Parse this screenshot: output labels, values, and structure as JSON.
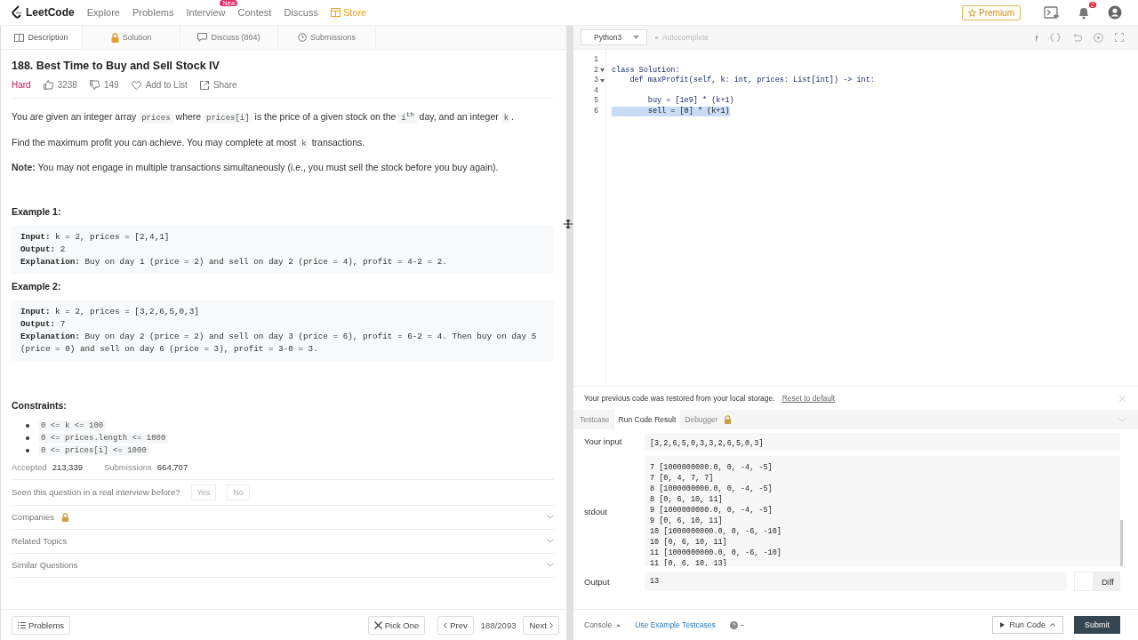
{
  "nav": {
    "logo": "LeetCode",
    "links": [
      {
        "label": "Explore",
        "kind": "plain"
      },
      {
        "label": "Problems",
        "kind": "plain"
      },
      {
        "label": "Interview",
        "kind": "plain",
        "badge": "New"
      },
      {
        "label": "Contest",
        "kind": "plain"
      },
      {
        "label": "Discuss",
        "kind": "plain"
      },
      {
        "label": "Store",
        "kind": "store"
      }
    ],
    "premium": "Premium",
    "notifications": "2"
  },
  "tabs": [
    {
      "label": "Description",
      "selected": true
    },
    {
      "label": "Solution",
      "selected": false
    },
    {
      "label": "Discuss (804)",
      "selected": false
    },
    {
      "label": "Submissions",
      "selected": false
    }
  ],
  "problem": {
    "title": "188. Best Time to Buy and Sell Stock IV",
    "difficulty": "Hard",
    "likes": "3238",
    "dislikes": "149",
    "add_to_list": "Add to List",
    "share": "Share"
  },
  "paragraphs": [
    [
      {
        "text": "You are given an integer array ",
        "kind": "text"
      },
      {
        "text": "prices",
        "kind": "code"
      },
      {
        "text": " where ",
        "kind": "text"
      },
      {
        "text": "prices[i]",
        "kind": "code"
      },
      {
        "text": " is the price of a given stock on the ",
        "kind": "text"
      },
      {
        "text": "i$^{th}$",
        "kind": "code"
      },
      {
        "text": " day, and an integer ",
        "kind": "text"
      },
      {
        "text": "k",
        "kind": "code"
      },
      {
        "text": ".",
        "kind": "text"
      }
    ],
    [
      {
        "text": "Find the maximum profit you can achieve. You may complete at most ",
        "kind": "text"
      },
      {
        "text": "k",
        "kind": "code"
      },
      {
        "text": " transactions.",
        "kind": "text"
      }
    ],
    [
      {
        "text": "**Note:** You may not engage in multiple transactions simultaneously (i.e., you must sell the stock before you buy again).",
        "kind": "text"
      }
    ]
  ],
  "examples": [
    {
      "title": "Example 1:",
      "lines": [
        {
          "label": "Input:",
          "text": "k = 2, prices = [2,4,1]"
        },
        {
          "label": "Output:",
          "text": "2"
        },
        {
          "label": "Explanation:",
          "text": "Buy on day 1 (price = 2) and sell on day 2 (price = 4), profit = 4-2 = 2."
        }
      ]
    },
    {
      "title": "Example 2:",
      "lines": [
        {
          "label": "Input:",
          "text": "k = 2, prices = [3,2,6,5,0,3]"
        },
        {
          "label": "Output:",
          "text": "7"
        },
        {
          "label": "Explanation:",
          "text": "Buy on day 2 (price = 2) and sell on day 3 (price = 6), profit = 6-2 = 4. Then buy on day 5 (price = 0) and sell on day 6 (price = 3), profit = 3-0 = 3."
        }
      ]
    }
  ],
  "constraints": {
    "title": "Constraints:",
    "items": [
      "0 <= k <= 100",
      "0 <= prices.length <= 1000",
      "0 <= prices[i] <= 1000"
    ]
  },
  "stats": [
    {
      "label": "Accepted",
      "value": "213,339"
    },
    {
      "label": "Submissions",
      "value": "664,707"
    }
  ],
  "interview": {
    "question": "Seen this question in a real interview before?",
    "answers": [
      "Yes",
      "No"
    ]
  },
  "sections": [
    {
      "label": "Companies",
      "locked": true
    },
    {
      "label": "Related Topics",
      "locked": false
    },
    {
      "label": "Similar Questions",
      "locked": false
    }
  ],
  "footer": {
    "problems": "Problems",
    "pick_one": "Pick One",
    "prev": "Prev",
    "counter": "188/2093",
    "next": "Next"
  },
  "editor": {
    "language": "Python3",
    "autocomplete": "Autocomplete",
    "lines": [
      {
        "num": "1",
        "fold": false,
        "selected": false
      },
      {
        "num": "2",
        "fold": true,
        "selected": false,
        "text": "class Solution:"
      },
      {
        "num": "3",
        "fold": true,
        "selected": false,
        "text": "    def maxProfit(self, k: int, prices: List[int]) -> int:"
      },
      {
        "num": "4",
        "fold": false,
        "selected": false
      },
      {
        "num": "5",
        "fold": false,
        "selected": false,
        "text": "        buy = [1e9] * (k+1)"
      },
      {
        "num": "6",
        "fold": false,
        "selected": true,
        "text": "        sell = [0] * (k+1)"
      }
    ]
  },
  "notice": {
    "text": "Your previous code was restored from your local storage.",
    "link": "Reset to default"
  },
  "result_tabs": [
    {
      "label": "Testcase",
      "selected": false,
      "locked": false
    },
    {
      "label": "Run Code Result",
      "selected": true,
      "locked": false
    },
    {
      "label": "Debugger",
      "selected": false,
      "locked": true
    }
  ],
  "result": {
    "input_label": "Your input",
    "input_lines": [
      "[3,2,6,5,0,3,3,2,6,5,0,3]"
    ],
    "stdout_label": "stdout",
    "stdout_lines": [
      "7 [1000000000.0, 0, -4, -5]",
      "7 [0, 4, 7, 7]",
      "8 [1000000000.0, 0, -4, -5]",
      "8 [0, 6, 10, 11]",
      "9 [1000000000.0, 0, -4, -5]",
      "9 [0, 6, 10, 11]",
      "10 [1000000000.0, 0, -6, -10]",
      "10 [0, 6, 10, 11]",
      "11 [1000000000.0, 0, -6, -10]",
      "11 [0, 6, 10, 13]"
    ],
    "output_label": "Output",
    "output": "13",
    "diff": "Diff"
  },
  "bottom": {
    "console": "Console",
    "example": "Use Example Testcases",
    "run": "Run Code",
    "submit": "Submit"
  }
}
